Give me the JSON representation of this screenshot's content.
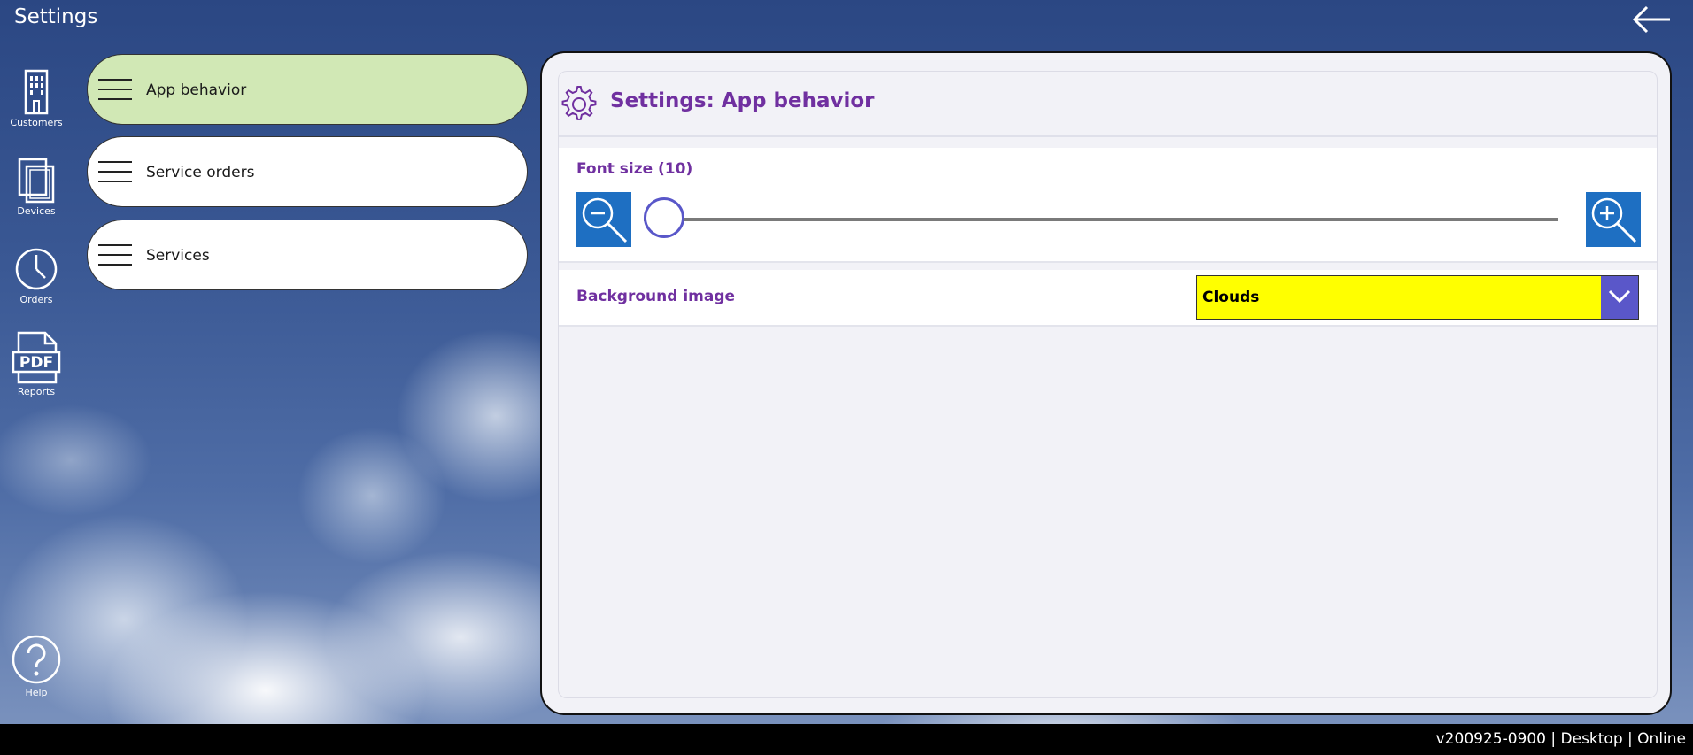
{
  "header": {
    "title": "Settings"
  },
  "rail": {
    "items": [
      {
        "label": "Customers",
        "icon": "building-icon"
      },
      {
        "label": "Devices",
        "icon": "devices-icon"
      },
      {
        "label": "Orders",
        "icon": "clock-icon"
      },
      {
        "label": "Reports",
        "icon": "pdf-icon"
      }
    ],
    "help_label": "Help"
  },
  "nav": {
    "items": [
      {
        "label": "App behavior",
        "active": true
      },
      {
        "label": "Service orders",
        "active": false
      },
      {
        "label": "Services",
        "active": false
      }
    ]
  },
  "panel": {
    "title": "Settings: App behavior",
    "font_size": {
      "label": "Font size (10)",
      "slider_fraction": 0.0
    },
    "background_image": {
      "label": "Background image",
      "selected": "Clouds"
    }
  },
  "status": {
    "text": "v200925-0900 | Desktop | Online"
  },
  "colors": {
    "accent_purple": "#7030a0",
    "active_nav": "#d1e8b5",
    "zoom_button": "#1e6fc2",
    "dropdown_bg": "#ffff00",
    "dropdown_chevron": "#5a57c9"
  }
}
